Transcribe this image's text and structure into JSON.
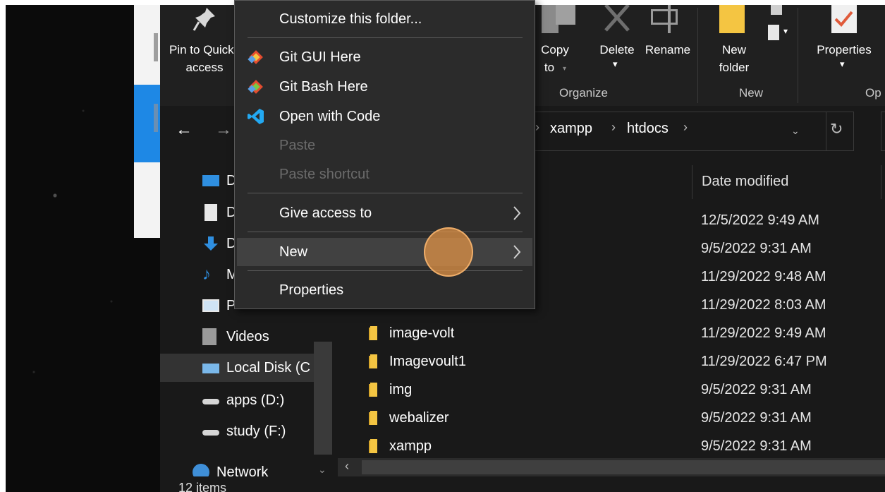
{
  "ribbon": {
    "pin_label_1": "Pin to Quick",
    "pin_label_2": "access",
    "copy_to_1": "Copy",
    "copy_to_2": "to",
    "delete": "Delete",
    "rename": "Rename",
    "new_folder_1": "New",
    "new_folder_2": "folder",
    "properties": "Properties",
    "group_organize": "Organize",
    "group_new": "New",
    "group_open": "Op"
  },
  "address": {
    "crumbs": [
      "xampp",
      "htdocs"
    ]
  },
  "columns": {
    "date_modified": "Date modified"
  },
  "files": [
    {
      "name": "",
      "date": "12/5/2022 9:49 AM"
    },
    {
      "name": "",
      "date": "9/5/2022 9:31 AM"
    },
    {
      "name": "",
      "date": "11/29/2022 9:48 AM"
    },
    {
      "name": "",
      "date": "11/29/2022 8:03 AM"
    },
    {
      "name": "image-volt",
      "date": "11/29/2022 9:49 AM"
    },
    {
      "name": "Imagevoult1",
      "date": "11/29/2022 6:47 PM"
    },
    {
      "name": "img",
      "date": "9/5/2022 9:31 AM"
    },
    {
      "name": "webalizer",
      "date": "9/5/2022 9:31 AM"
    },
    {
      "name": "xampp",
      "date": "9/5/2022 9:31 AM"
    }
  ],
  "nav": {
    "desktop": "D",
    "documents": "D",
    "downloads": "D",
    "music": "M",
    "pictures": "P",
    "videos": "Videos",
    "local_disk": "Local Disk (C",
    "apps": "apps (D:)",
    "study": "study (F:)",
    "network": "Network"
  },
  "status": {
    "items": "12 items"
  },
  "context_menu": {
    "customize": "Customize this folder...",
    "git_gui": "Git GUI Here",
    "git_bash": "Git Bash Here",
    "open_code": "Open with Code",
    "paste": "Paste",
    "paste_shortcut": "Paste shortcut",
    "give_access": "Give access to",
    "new": "New",
    "properties": "Properties"
  },
  "colors": {
    "explorer_bg": "#191919",
    "menu_bg": "#2b2b2b",
    "menu_hover": "#414141",
    "folder_yellow": "#f4c542",
    "cursor_highlight": "#e6964a"
  }
}
